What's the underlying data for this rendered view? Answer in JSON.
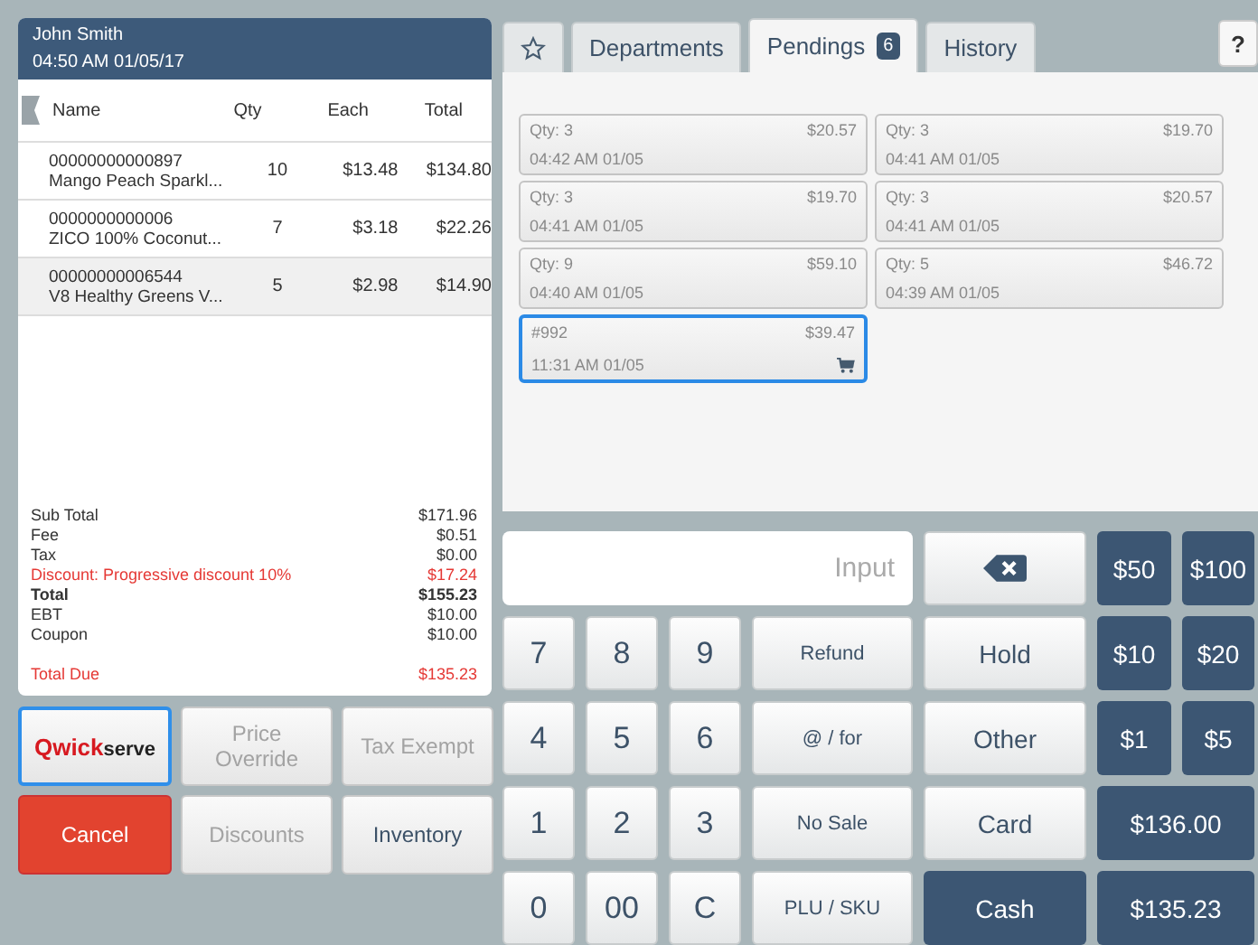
{
  "order": {
    "customer": "John Smith",
    "datetime": "04:50 AM 01/05/17",
    "columns": [
      "Name",
      "Qty",
      "Each",
      "Total"
    ],
    "rows": [
      {
        "code": "00000000000897",
        "name": "Mango Peach Sparkl...",
        "qty": "10",
        "each": "$13.48",
        "total": "$134.80",
        "selected": false
      },
      {
        "code": "0000000000006",
        "name": "ZICO 100% Coconut...",
        "qty": "7",
        "each": "$3.18",
        "total": "$22.26",
        "selected": false
      },
      {
        "code": "00000000006544",
        "name": "V8 Healthy Greens V...",
        "qty": "5",
        "each": "$2.98",
        "total": "$14.90",
        "selected": true
      }
    ],
    "summary": [
      {
        "label": "Sub Total",
        "value": "$171.96",
        "kind": "normal"
      },
      {
        "label": "Fee",
        "value": "$0.51",
        "kind": "normal"
      },
      {
        "label": "Tax",
        "value": "$0.00",
        "kind": "normal"
      },
      {
        "label": "Discount: Progressive discount 10%",
        "value": "$17.24",
        "kind": "discount"
      },
      {
        "label": "Total",
        "value": "$155.23",
        "kind": "bold"
      },
      {
        "label": "EBT",
        "value": "$10.00",
        "kind": "normal"
      },
      {
        "label": "Coupon",
        "value": "$10.00",
        "kind": "normal"
      },
      {
        "label": "Total Due",
        "value": "$135.23",
        "kind": "due"
      }
    ]
  },
  "left_buttons": [
    {
      "kind": "logo",
      "logo_mark": "Qwick",
      "logo_rest": "serve",
      "selected": true
    },
    {
      "kind": "plain",
      "label": "Price Override",
      "disabled": true
    },
    {
      "kind": "plain",
      "label": "Tax Exempt",
      "disabled": true
    },
    {
      "kind": "danger",
      "label": "Cancel",
      "disabled": false
    },
    {
      "kind": "plain",
      "label": "Discounts",
      "disabled": true
    },
    {
      "kind": "plain",
      "label": "Inventory",
      "disabled": false
    }
  ],
  "tabs": [
    {
      "kind": "star",
      "selected": false
    },
    {
      "kind": "text",
      "label": "Departments",
      "selected": false
    },
    {
      "kind": "text",
      "label": "Pendings",
      "badge": "6",
      "selected": true
    },
    {
      "kind": "text",
      "label": "History",
      "selected": false
    }
  ],
  "help": "?",
  "pendings": [
    {
      "title": "Qty: 3",
      "amount": "$20.57",
      "time": "04:42 AM 01/05",
      "selected": false,
      "cart": false
    },
    {
      "title": "Qty: 3",
      "amount": "$19.70",
      "time": "04:41 AM 01/05",
      "selected": false,
      "cart": false
    },
    {
      "title": "Qty: 3",
      "amount": "$19.70",
      "time": "04:41 AM 01/05",
      "selected": false,
      "cart": false
    },
    {
      "title": "Qty: 3",
      "amount": "$20.57",
      "time": "04:41 AM 01/05",
      "selected": false,
      "cart": false
    },
    {
      "title": "Qty: 9",
      "amount": "$59.10",
      "time": "04:40 AM 01/05",
      "selected": false,
      "cart": false
    },
    {
      "title": "Qty: 5",
      "amount": "$46.72",
      "time": "04:39 AM 01/05",
      "selected": false,
      "cart": false
    },
    {
      "title": "#992",
      "amount": "$39.47",
      "time": "11:31 AM 01/05",
      "selected": true,
      "cart": true
    }
  ],
  "input": {
    "placeholder": "Input"
  },
  "keys": [
    {
      "kind": "backspace"
    },
    {
      "kind": "dark",
      "label": "$50"
    },
    {
      "kind": "dark",
      "label": "$100"
    },
    {
      "kind": "digit",
      "label": "7"
    },
    {
      "kind": "digit",
      "label": "8"
    },
    {
      "kind": "digit",
      "label": "9"
    },
    {
      "kind": "small",
      "label": "Refund"
    },
    {
      "kind": "action",
      "label": "Hold"
    },
    {
      "kind": "dark",
      "label": "$10"
    },
    {
      "kind": "dark",
      "label": "$20"
    },
    {
      "kind": "digit",
      "label": "4"
    },
    {
      "kind": "digit",
      "label": "5"
    },
    {
      "kind": "digit",
      "label": "6"
    },
    {
      "kind": "small",
      "label": "@ / for"
    },
    {
      "kind": "action",
      "label": "Other"
    },
    {
      "kind": "dark",
      "label": "$1"
    },
    {
      "kind": "dark",
      "label": "$5"
    },
    {
      "kind": "digit",
      "label": "1"
    },
    {
      "kind": "digit",
      "label": "2"
    },
    {
      "kind": "digit",
      "label": "3"
    },
    {
      "kind": "small",
      "label": "No Sale"
    },
    {
      "kind": "action",
      "label": "Card"
    },
    {
      "kind": "wide",
      "label": "$136.00"
    },
    {
      "kind": "digit",
      "label": "0"
    },
    {
      "kind": "digit",
      "label": "00"
    },
    {
      "kind": "digit",
      "label": "C"
    },
    {
      "kind": "small",
      "label": "PLU / SKU"
    },
    {
      "kind": "dark-action",
      "label": "Cash"
    },
    {
      "kind": "wide",
      "label": "$135.23"
    }
  ]
}
